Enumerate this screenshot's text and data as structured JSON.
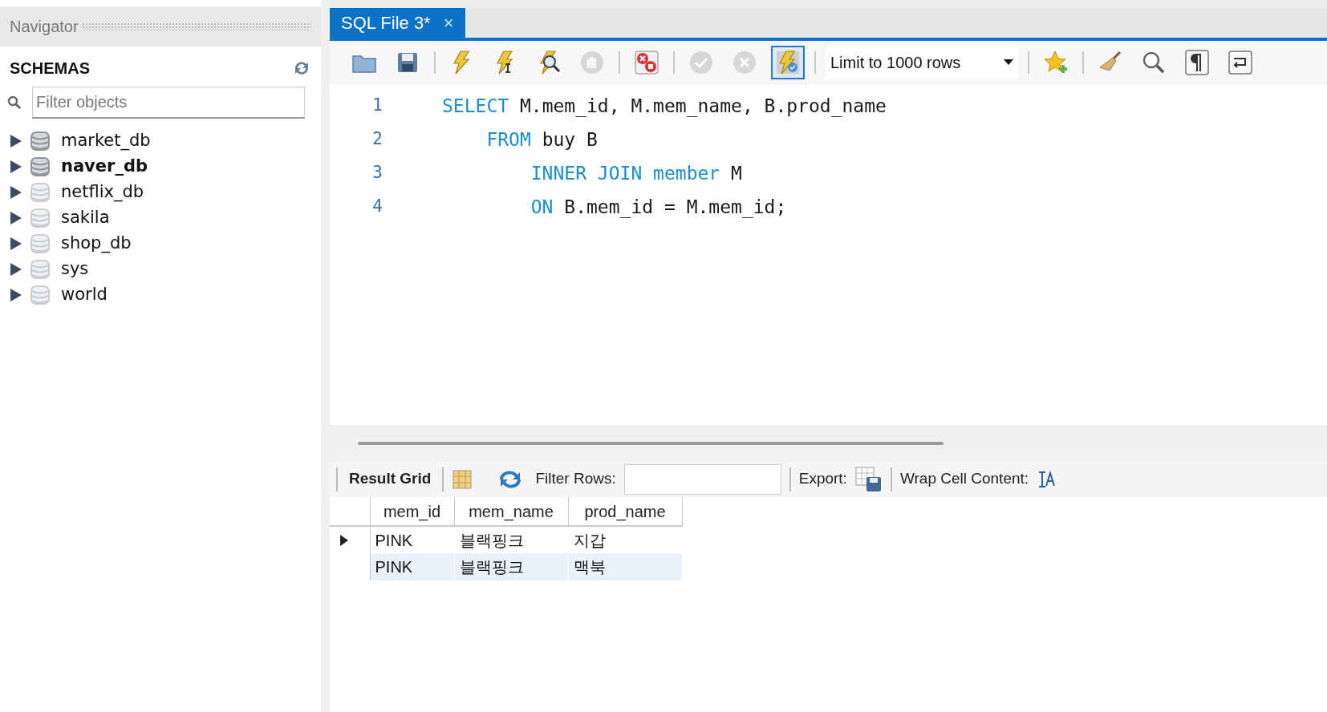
{
  "navigator": {
    "title": "Navigator",
    "section": "SCHEMAS",
    "filter": {
      "placeholder": "Filter objects"
    },
    "schemas": [
      {
        "name": "market_db",
        "active": false,
        "loaded": true
      },
      {
        "name": "naver_db",
        "active": true,
        "loaded": true
      },
      {
        "name": "netflix_db",
        "active": false,
        "loaded": false
      },
      {
        "name": "sakila",
        "active": false,
        "loaded": false
      },
      {
        "name": "shop_db",
        "active": false,
        "loaded": false
      },
      {
        "name": "sys",
        "active": false,
        "loaded": false
      },
      {
        "name": "world",
        "active": false,
        "loaded": false
      }
    ]
  },
  "tabs": [
    {
      "label": "SQL File 3*",
      "close": "×",
      "selected": true
    }
  ],
  "toolbar": {
    "limit": {
      "label": "Limit to 1000 rows"
    },
    "groups": [
      [
        {
          "kind": "open",
          "disabled": false,
          "pressed": false
        },
        {
          "kind": "save",
          "disabled": false,
          "pressed": false
        }
      ],
      [
        {
          "kind": "execute",
          "disabled": false,
          "pressed": false
        },
        {
          "kind": "execute_current",
          "disabled": false,
          "pressed": false
        },
        {
          "kind": "explain",
          "disabled": false,
          "pressed": false
        },
        {
          "kind": "stop",
          "disabled": true,
          "pressed": false
        }
      ],
      [
        {
          "kind": "stop_on_error",
          "disabled": false,
          "pressed": false
        }
      ],
      [
        {
          "kind": "commit",
          "disabled": true,
          "pressed": false
        },
        {
          "kind": "rollback",
          "disabled": true,
          "pressed": false
        },
        {
          "kind": "autocommit",
          "disabled": false,
          "pressed": true
        }
      ],
      [
        {
          "kind": "snippet",
          "disabled": false,
          "pressed": false
        }
      ],
      [
        {
          "kind": "beautify",
          "disabled": false,
          "pressed": false
        },
        {
          "kind": "find",
          "disabled": false,
          "pressed": false
        },
        {
          "kind": "invisibles",
          "disabled": false,
          "pressed": false
        },
        {
          "kind": "wrap",
          "disabled": false,
          "pressed": false
        }
      ]
    ]
  },
  "editor": {
    "lines": [
      {
        "number": "1",
        "tokens": [
          {
            "text": "SELECT",
            "kind": "keyword"
          },
          {
            "text": " M.mem_id, M.mem_name, B.prod_name",
            "kind": "plain"
          }
        ]
      },
      {
        "number": "2",
        "tokens": [
          {
            "text": "    FROM",
            "kind": "keyword"
          },
          {
            "text": " buy B",
            "kind": "plain"
          }
        ]
      },
      {
        "number": "3",
        "tokens": [
          {
            "text": "        INNER JOIN member",
            "kind": "keyword"
          },
          {
            "text": " M",
            "kind": "plain"
          }
        ]
      },
      {
        "number": "4",
        "tokens": [
          {
            "text": "        ON",
            "kind": "keyword"
          },
          {
            "text": " B.mem_id = M.mem_id;",
            "kind": "plain"
          }
        ]
      }
    ]
  },
  "result": {
    "toolbar": {
      "view": "Result Grid",
      "filter_label": "Filter Rows:",
      "export_label": "Export:",
      "wrap_label": "Wrap Cell Content:"
    },
    "columns": [
      "mem_id",
      "mem_name",
      "prod_name"
    ],
    "rows": [
      {
        "current": true,
        "selected": false,
        "cells": [
          "PINK",
          "블랙핑크",
          "지갑"
        ]
      },
      {
        "current": false,
        "selected": true,
        "cells": [
          "PINK",
          "블랙핑크",
          "맥북"
        ]
      }
    ]
  }
}
